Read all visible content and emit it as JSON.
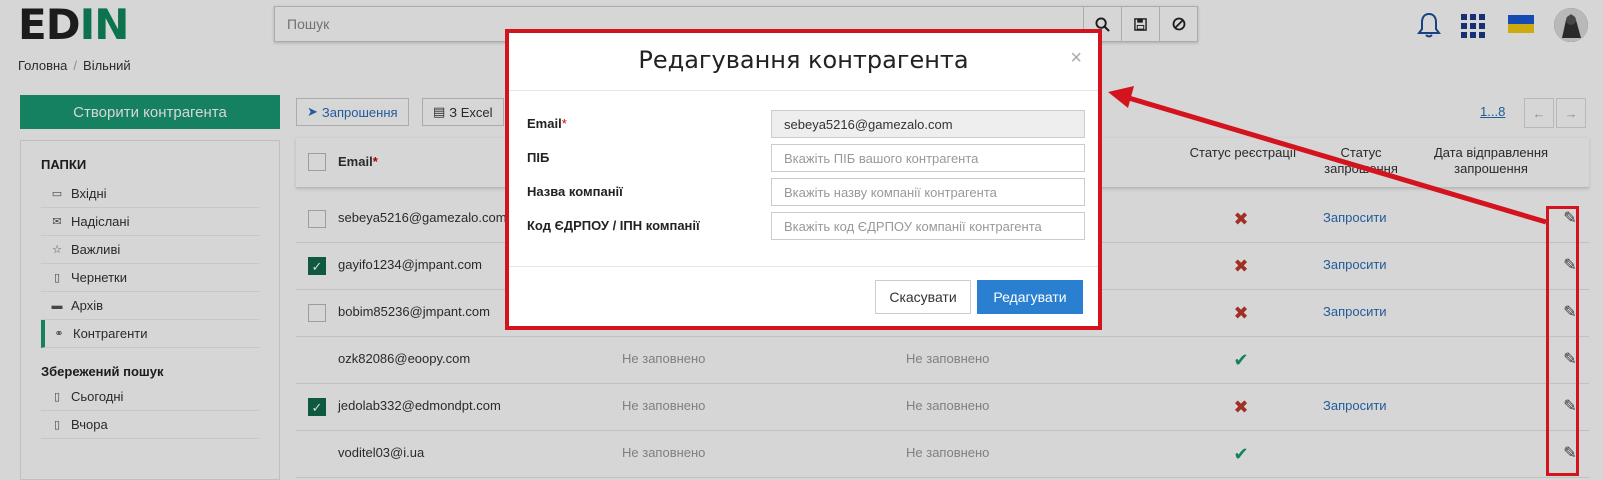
{
  "logo": {
    "left": "ED",
    "right": "IN"
  },
  "search": {
    "placeholder": "Пошук"
  },
  "breadcrumb": {
    "home": "Головна",
    "current": "Вільний"
  },
  "sidebar": {
    "create_label": "Створити контрагента",
    "folders_title": "ПАПКИ",
    "folders": [
      "Вхідні",
      "Надіслані",
      "Важливі",
      "Чернетки",
      "Архів",
      "Контрагенти"
    ],
    "saved_title": "Збережений пошук",
    "saved": [
      "Сьогодні",
      "Вчора"
    ]
  },
  "toolbar": {
    "invite_label": "Запрошення",
    "excel_label": "З Excel",
    "pager": "1...8"
  },
  "table": {
    "headers": {
      "email": "Email",
      "reg_status": "Статус реєстрації",
      "invite_status": "Статус запрошення",
      "invite_date": "Дата відправлення запрошення"
    },
    "rows": [
      {
        "email": "sebeya5216@gamezalo.com",
        "checked": false,
        "pib": "",
        "company": "",
        "status": "bad",
        "invite": "Запросити"
      },
      {
        "email": "gayifo1234@jmpant.com",
        "checked": true,
        "pib": "",
        "company": "",
        "status": "bad",
        "invite": "Запросити"
      },
      {
        "email": "bobim85236@jmpant.com",
        "checked": false,
        "pib": "",
        "company": "",
        "status": "bad",
        "invite": "Запросити"
      },
      {
        "email": "ozk82086@eoopy.com",
        "checked": false,
        "pib": "Не заповнено",
        "company": "Не заповнено",
        "status": "ok",
        "invite": ""
      },
      {
        "email": "jedolab332@edmondpt.com",
        "checked": true,
        "pib": "Не заповнено",
        "company": "Не заповнено",
        "status": "bad",
        "invite": "Запросити"
      },
      {
        "email": "voditel03@i.ua",
        "checked": false,
        "pib": "Не заповнено",
        "company": "Не заповнено",
        "status": "ok",
        "invite": ""
      }
    ]
  },
  "modal": {
    "title": "Редагування контрагента",
    "close": "×",
    "fields": {
      "email_label": "Email",
      "email_value": "sebeya5216@gamezalo.com",
      "pib_label": "ПІБ",
      "pib_placeholder": "Вкажіть ПІБ вашого контрагента",
      "company_label": "Назва компанії",
      "company_placeholder": "Вкажіть назву компанії контрагента",
      "code_label": "Код ЄДРПОУ / ІПН компанії",
      "code_placeholder": "Вкажіть код ЄДРПОУ компанії контрагента"
    },
    "cancel_label": "Скасувати",
    "save_label": "Редагувати"
  },
  "colors": {
    "brand": "#1a9a73",
    "accent": "#2a7fd1",
    "annotation": "#d3141f"
  }
}
